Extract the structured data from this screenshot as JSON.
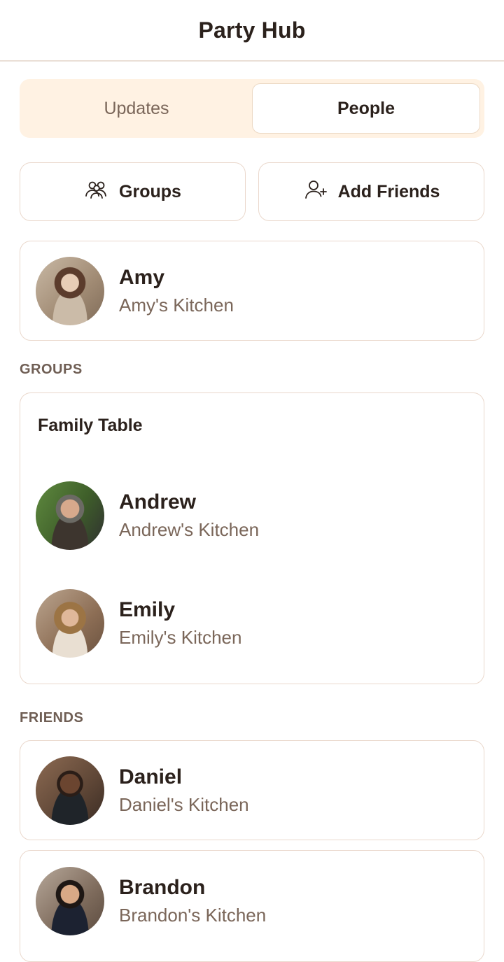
{
  "header": {
    "title": "Party Hub"
  },
  "tabs": [
    {
      "label": "Updates",
      "selected": false
    },
    {
      "label": "People",
      "selected": true
    }
  ],
  "actions": {
    "groups_label": "Groups",
    "groups_icon": "group-icon",
    "add_friends_label": "Add Friends",
    "add_friends_icon": "add-person-icon"
  },
  "me": {
    "name": "Amy",
    "subtitle": "Amy's Kitchen"
  },
  "groups_section": {
    "label": "GROUPS",
    "groups": [
      {
        "title": "Family Table",
        "members": [
          {
            "name": "Andrew",
            "subtitle": "Andrew's Kitchen"
          },
          {
            "name": "Emily",
            "subtitle": "Emily's Kitchen"
          }
        ]
      }
    ]
  },
  "friends_section": {
    "label": "FRIENDS",
    "friends": [
      {
        "name": "Daniel",
        "subtitle": "Daniel's Kitchen"
      },
      {
        "name": "Brandon",
        "subtitle": "Brandon's Kitchen"
      }
    ]
  },
  "colors": {
    "accent_bg": "#fff2e3",
    "border": "#ead8cc",
    "text_primary": "#2b211c",
    "text_secondary": "#7a6659"
  }
}
